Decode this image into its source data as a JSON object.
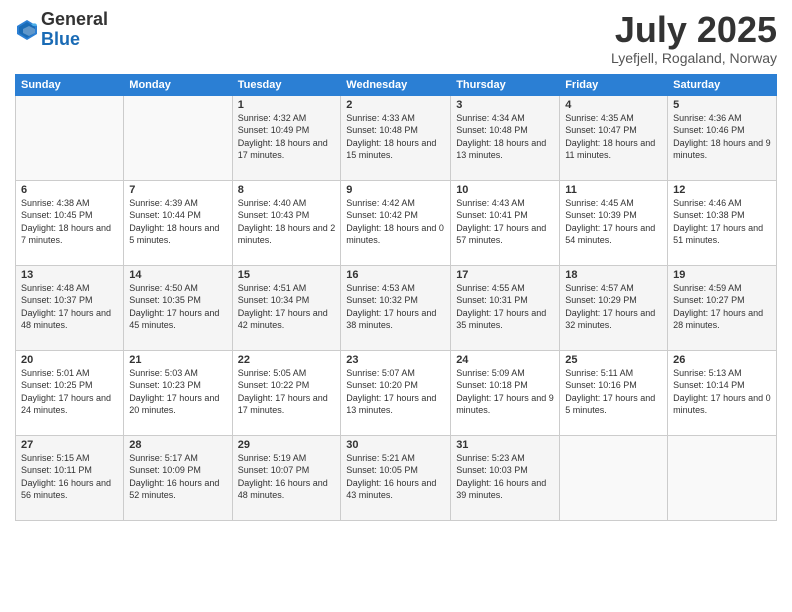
{
  "header": {
    "logo_general": "General",
    "logo_blue": "Blue",
    "month_title": "July 2025",
    "location": "Lyefjell, Rogaland, Norway"
  },
  "days_of_week": [
    "Sunday",
    "Monday",
    "Tuesday",
    "Wednesday",
    "Thursday",
    "Friday",
    "Saturday"
  ],
  "weeks": [
    [
      {
        "day": "",
        "info": ""
      },
      {
        "day": "",
        "info": ""
      },
      {
        "day": "1",
        "info": "Sunrise: 4:32 AM\nSunset: 10:49 PM\nDaylight: 18 hours and 17 minutes."
      },
      {
        "day": "2",
        "info": "Sunrise: 4:33 AM\nSunset: 10:48 PM\nDaylight: 18 hours and 15 minutes."
      },
      {
        "day": "3",
        "info": "Sunrise: 4:34 AM\nSunset: 10:48 PM\nDaylight: 18 hours and 13 minutes."
      },
      {
        "day": "4",
        "info": "Sunrise: 4:35 AM\nSunset: 10:47 PM\nDaylight: 18 hours and 11 minutes."
      },
      {
        "day": "5",
        "info": "Sunrise: 4:36 AM\nSunset: 10:46 PM\nDaylight: 18 hours and 9 minutes."
      }
    ],
    [
      {
        "day": "6",
        "info": "Sunrise: 4:38 AM\nSunset: 10:45 PM\nDaylight: 18 hours and 7 minutes."
      },
      {
        "day": "7",
        "info": "Sunrise: 4:39 AM\nSunset: 10:44 PM\nDaylight: 18 hours and 5 minutes."
      },
      {
        "day": "8",
        "info": "Sunrise: 4:40 AM\nSunset: 10:43 PM\nDaylight: 18 hours and 2 minutes."
      },
      {
        "day": "9",
        "info": "Sunrise: 4:42 AM\nSunset: 10:42 PM\nDaylight: 18 hours and 0 minutes."
      },
      {
        "day": "10",
        "info": "Sunrise: 4:43 AM\nSunset: 10:41 PM\nDaylight: 17 hours and 57 minutes."
      },
      {
        "day": "11",
        "info": "Sunrise: 4:45 AM\nSunset: 10:39 PM\nDaylight: 17 hours and 54 minutes."
      },
      {
        "day": "12",
        "info": "Sunrise: 4:46 AM\nSunset: 10:38 PM\nDaylight: 17 hours and 51 minutes."
      }
    ],
    [
      {
        "day": "13",
        "info": "Sunrise: 4:48 AM\nSunset: 10:37 PM\nDaylight: 17 hours and 48 minutes."
      },
      {
        "day": "14",
        "info": "Sunrise: 4:50 AM\nSunset: 10:35 PM\nDaylight: 17 hours and 45 minutes."
      },
      {
        "day": "15",
        "info": "Sunrise: 4:51 AM\nSunset: 10:34 PM\nDaylight: 17 hours and 42 minutes."
      },
      {
        "day": "16",
        "info": "Sunrise: 4:53 AM\nSunset: 10:32 PM\nDaylight: 17 hours and 38 minutes."
      },
      {
        "day": "17",
        "info": "Sunrise: 4:55 AM\nSunset: 10:31 PM\nDaylight: 17 hours and 35 minutes."
      },
      {
        "day": "18",
        "info": "Sunrise: 4:57 AM\nSunset: 10:29 PM\nDaylight: 17 hours and 32 minutes."
      },
      {
        "day": "19",
        "info": "Sunrise: 4:59 AM\nSunset: 10:27 PM\nDaylight: 17 hours and 28 minutes."
      }
    ],
    [
      {
        "day": "20",
        "info": "Sunrise: 5:01 AM\nSunset: 10:25 PM\nDaylight: 17 hours and 24 minutes."
      },
      {
        "day": "21",
        "info": "Sunrise: 5:03 AM\nSunset: 10:23 PM\nDaylight: 17 hours and 20 minutes."
      },
      {
        "day": "22",
        "info": "Sunrise: 5:05 AM\nSunset: 10:22 PM\nDaylight: 17 hours and 17 minutes."
      },
      {
        "day": "23",
        "info": "Sunrise: 5:07 AM\nSunset: 10:20 PM\nDaylight: 17 hours and 13 minutes."
      },
      {
        "day": "24",
        "info": "Sunrise: 5:09 AM\nSunset: 10:18 PM\nDaylight: 17 hours and 9 minutes."
      },
      {
        "day": "25",
        "info": "Sunrise: 5:11 AM\nSunset: 10:16 PM\nDaylight: 17 hours and 5 minutes."
      },
      {
        "day": "26",
        "info": "Sunrise: 5:13 AM\nSunset: 10:14 PM\nDaylight: 17 hours and 0 minutes."
      }
    ],
    [
      {
        "day": "27",
        "info": "Sunrise: 5:15 AM\nSunset: 10:11 PM\nDaylight: 16 hours and 56 minutes."
      },
      {
        "day": "28",
        "info": "Sunrise: 5:17 AM\nSunset: 10:09 PM\nDaylight: 16 hours and 52 minutes."
      },
      {
        "day": "29",
        "info": "Sunrise: 5:19 AM\nSunset: 10:07 PM\nDaylight: 16 hours and 48 minutes."
      },
      {
        "day": "30",
        "info": "Sunrise: 5:21 AM\nSunset: 10:05 PM\nDaylight: 16 hours and 43 minutes."
      },
      {
        "day": "31",
        "info": "Sunrise: 5:23 AM\nSunset: 10:03 PM\nDaylight: 16 hours and 39 minutes."
      },
      {
        "day": "",
        "info": ""
      },
      {
        "day": "",
        "info": ""
      }
    ]
  ]
}
